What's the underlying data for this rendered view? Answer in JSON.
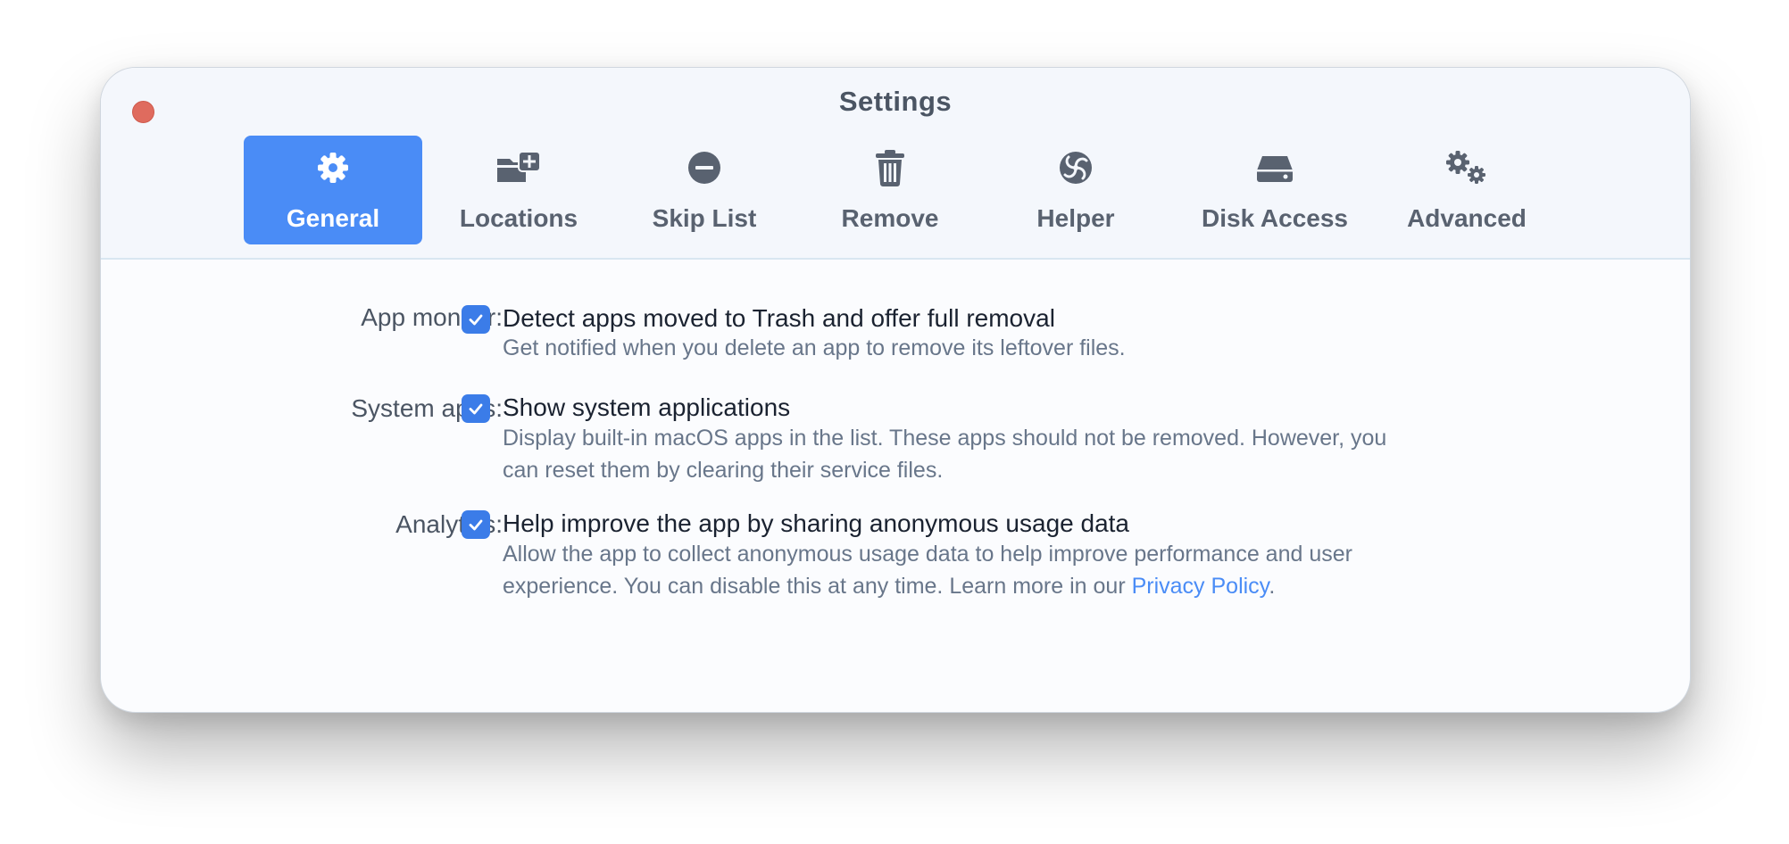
{
  "window": {
    "title": "Settings"
  },
  "tabs": [
    {
      "label": "General",
      "icon": "gear-icon",
      "active": true
    },
    {
      "label": "Locations",
      "icon": "folder-plus-icon",
      "active": false
    },
    {
      "label": "Skip List",
      "icon": "minus-circle-icon",
      "active": false
    },
    {
      "label": "Remove",
      "icon": "trash-icon",
      "active": false
    },
    {
      "label": "Helper",
      "icon": "helper-swirl-icon",
      "active": false
    },
    {
      "label": "Disk Access",
      "icon": "disk-drive-icon",
      "active": false
    },
    {
      "label": "Advanced",
      "icon": "gears-icon",
      "active": false
    }
  ],
  "settings": {
    "app_monitor": {
      "label": "App monitor:",
      "checked": true,
      "title": "Detect apps moved to Trash and offer full removal",
      "description": "Get notified when you delete an app to remove its leftover files."
    },
    "system_apps": {
      "label": "System apps:",
      "checked": true,
      "title": "Show system applications",
      "description_line1": "Display built-in macOS apps in the list. These apps should not be removed. However, you",
      "description_line2": "can reset them by clearing their service files."
    },
    "analytics": {
      "label": "Analytics:",
      "checked": true,
      "title": "Help improve the app by sharing anonymous usage data",
      "description_line1": "Allow the app to collect anonymous usage data to help improve performance and user",
      "description_line2_prefix": "experience. You can disable this at any time. Learn more in our ",
      "privacy_link": "Privacy Policy",
      "description_line2_suffix": "."
    }
  },
  "colors": {
    "accent": "#4a8cf6",
    "checkbox": "#3b7ce8",
    "close_button": "#df6b5e"
  }
}
